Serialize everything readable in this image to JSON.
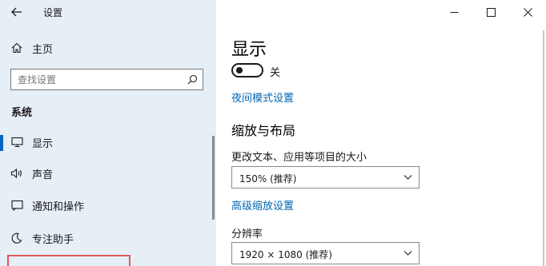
{
  "window": {
    "title": "设置",
    "icons": {
      "back": "back-arrow-icon",
      "minimize": "minimize-icon",
      "maximize": "maximize-icon",
      "close": "close-icon"
    }
  },
  "sidebar": {
    "home_label": "主页",
    "search_placeholder": "查找设置",
    "section_title": "系统",
    "items": [
      {
        "label": "显示",
        "icon": "monitor-icon",
        "active": true
      },
      {
        "label": "声音",
        "icon": "speaker-icon",
        "active": false
      },
      {
        "label": "通知和操作",
        "icon": "notification-icon",
        "active": false
      },
      {
        "label": "专注助手",
        "icon": "moon-icon",
        "active": false
      }
    ]
  },
  "content": {
    "title": "显示",
    "night_light": {
      "state_label": "关",
      "on": false
    },
    "night_light_link": "夜间模式设置",
    "scale_section_title": "缩放与布局",
    "scale_label": "更改文本、应用等项目的大小",
    "scale_value": "150% (推荐)",
    "advanced_scaling_link": "高级缩放设置",
    "resolution_label": "分辨率",
    "resolution_value": "1920 × 1080 (推荐)"
  },
  "colors": {
    "sidebar_bg": "#e6eef6",
    "accent": "#0067c0",
    "link": "#0066b4",
    "highlight_border": "#e05a5a"
  }
}
